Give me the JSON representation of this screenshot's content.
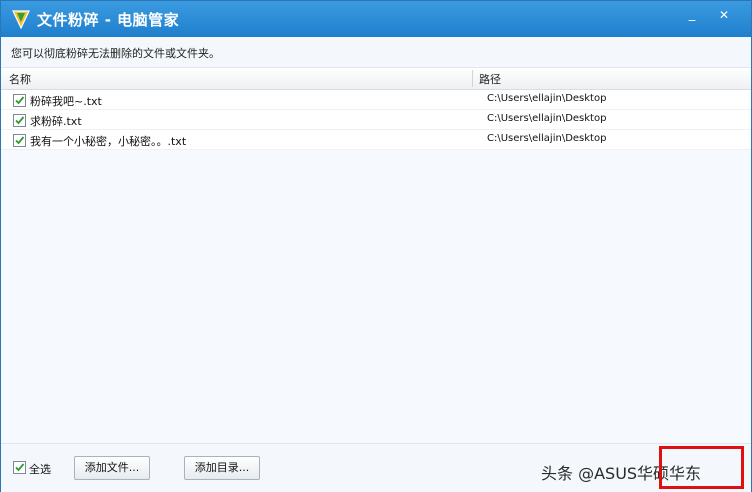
{
  "window": {
    "title": "文件粉碎 - 电脑管家",
    "minimize_glyph": "_",
    "close_glyph": "✕"
  },
  "description": "您可以彻底粉碎无法删除的文件或文件夹。",
  "list": {
    "columns": [
      "名称",
      "路径"
    ],
    "rows": [
      {
        "name": "粉碎我吧~.txt",
        "path": "C:\\Users\\ellajin\\Desktop",
        "checked": true
      },
      {
        "name": "求粉碎.txt",
        "path": "C:\\Users\\ellajin\\Desktop",
        "checked": true
      },
      {
        "name": "我有一个小秘密，小秘密。。.txt",
        "path": "C:\\Users\\ellajin\\Desktop",
        "checked": true
      }
    ]
  },
  "footer": {
    "select_all_label": "全选",
    "select_all_checked": true,
    "add_file_label": "添加文件...",
    "add_dir_label": "添加目录...",
    "watermark": "头条 @ASUS华硕华东"
  },
  "colors": {
    "titlebar": "#1f7fce",
    "check": "#2e9a2e",
    "highlight_box": "#e01010"
  }
}
